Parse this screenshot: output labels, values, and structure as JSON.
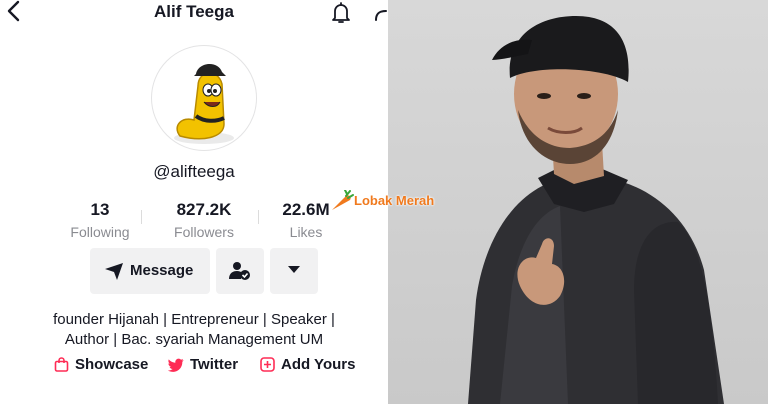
{
  "header": {
    "title": "Alif Teega"
  },
  "profile": {
    "username": "@alifteega"
  },
  "stats": [
    {
      "value": "13",
      "label": "Following"
    },
    {
      "value": "827.2K",
      "label": "Followers"
    },
    {
      "value": "22.6M",
      "label": "Likes"
    }
  ],
  "actions": {
    "message_label": "Message"
  },
  "bio": {
    "line1": "founder Hijanah | Entrepreneur | Speaker |",
    "line2": "Author | Bac. syariah Management UM"
  },
  "links": [
    {
      "label": "Showcase",
      "icon": "shopping-bag-icon"
    },
    {
      "label": "Twitter",
      "icon": "twitter-bird-icon"
    },
    {
      "label": "Add Yours",
      "icon": "add-yours-icon"
    }
  ],
  "watermark": {
    "text": "Lobak Merah"
  },
  "colors": {
    "accent": "#fe2c55",
    "secondary_text": "#8a8b91",
    "button_bg": "#f1f1f2",
    "watermark": "#f07a1e"
  }
}
